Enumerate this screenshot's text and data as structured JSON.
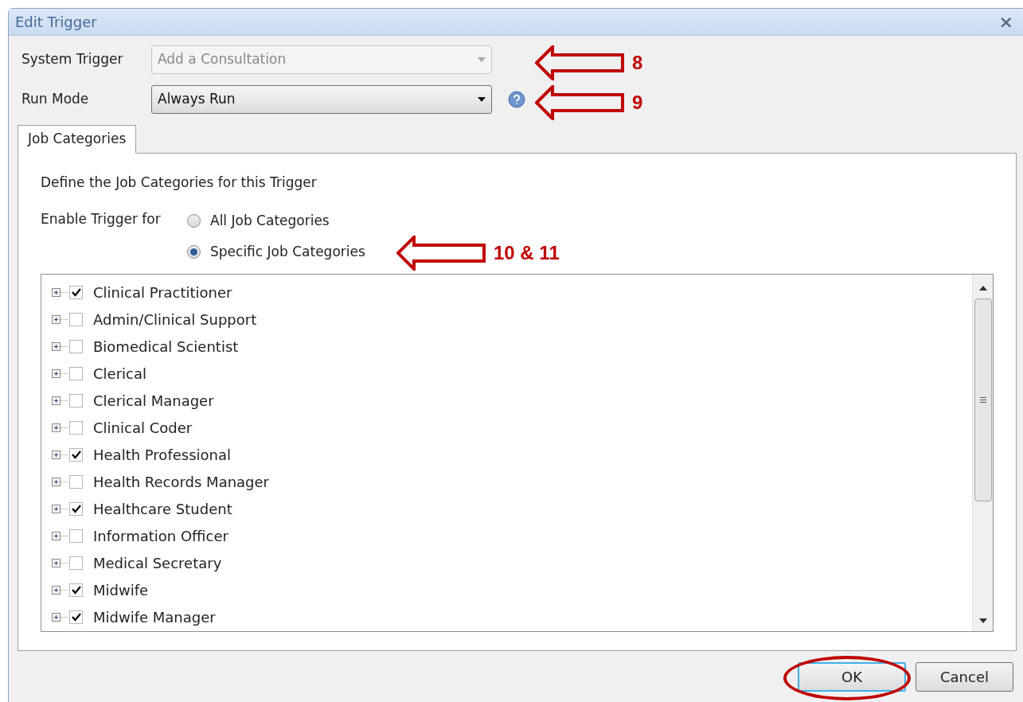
{
  "window": {
    "title": "Edit Trigger",
    "close": "×"
  },
  "fields": [
    {
      "label": "System Trigger",
      "value": "Add a Consultation",
      "disabled": true
    },
    {
      "label": "Run Mode",
      "value": "Always Run",
      "disabled": false
    }
  ],
  "tabs": [
    {
      "label": "Job Categories",
      "selected": true
    }
  ],
  "panel": {
    "heading": "Define the Job Categories for this Trigger",
    "enable_label": "Enable Trigger for",
    "radios": [
      {
        "label": "All Job Categories",
        "selected": false
      },
      {
        "label": "Specific Job Categories",
        "selected": true
      }
    ]
  },
  "tree": [
    {
      "label": "Clinical Practitioner",
      "checked": true
    },
    {
      "label": "Admin/Clinical Support",
      "checked": false
    },
    {
      "label": "Biomedical Scientist",
      "checked": false
    },
    {
      "label": "Clerical",
      "checked": false
    },
    {
      "label": "Clerical Manager",
      "checked": false
    },
    {
      "label": "Clinical Coder",
      "checked": false
    },
    {
      "label": "Health Professional",
      "checked": true
    },
    {
      "label": "Health Records Manager",
      "checked": false
    },
    {
      "label": "Healthcare Student",
      "checked": true
    },
    {
      "label": "Information Officer",
      "checked": false
    },
    {
      "label": "Medical Secretary",
      "checked": false
    },
    {
      "label": "Midwife",
      "checked": true
    },
    {
      "label": "Midwife Manager",
      "checked": true
    }
  ],
  "buttons": [
    "OK",
    "Cancel"
  ],
  "annotations": [
    {
      "kind": "arrow",
      "label": "8"
    },
    {
      "kind": "arrow",
      "label": "9"
    },
    {
      "kind": "arrow",
      "label": "10 & 11"
    },
    {
      "kind": "ellipse"
    }
  ]
}
